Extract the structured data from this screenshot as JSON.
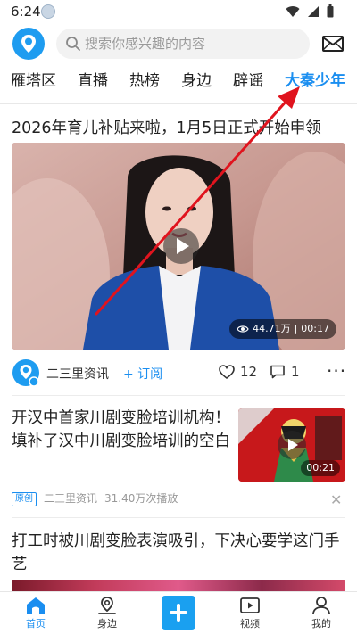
{
  "status_bar": {
    "time": "6:24",
    "icons": [
      "user-status-icon",
      "wifi-icon",
      "signal-icon",
      "battery-icon"
    ]
  },
  "header": {
    "logo_icon": "location-pin-logo-icon",
    "search": {
      "placeholder": "搜索你感兴趣的内容"
    },
    "mail_icon": "mail-icon"
  },
  "tabs": [
    {
      "label": "雁塔区",
      "active": false
    },
    {
      "label": "直播",
      "active": false
    },
    {
      "label": "热榜",
      "active": false
    },
    {
      "label": "身边",
      "active": false
    },
    {
      "label": "辟谣",
      "active": false
    },
    {
      "label": "大秦少年",
      "active": true
    }
  ],
  "featured": {
    "title": "2026年育儿补贴来啦，1月5日正式开始申领",
    "views": "44.71万",
    "duration": "00:17",
    "author": "二三里资讯",
    "subscribe_label": "+ 订阅",
    "likes": "12",
    "comments": "1"
  },
  "article2": {
    "title": "开汉中首家川剧变脸培训机构！填补了汉中川剧变脸培训的空白",
    "badge": "原创",
    "source": "二三里资讯",
    "plays": "31.40万次播放",
    "duration": "00:21"
  },
  "article3": {
    "title": "打工时被川剧变脸表演吸引，下决心要学这门手艺"
  },
  "bottom_nav": [
    {
      "label": "首页",
      "icon": "home-icon",
      "active": true
    },
    {
      "label": "身边",
      "icon": "nearby-pin-icon",
      "active": false
    },
    {
      "label": "",
      "icon": "publish-plus-icon",
      "active": false
    },
    {
      "label": "视频",
      "icon": "video-icon",
      "active": false
    },
    {
      "label": "我的",
      "icon": "profile-icon",
      "active": false
    }
  ],
  "colors": {
    "accent": "#1a8ef0",
    "annotation_arrow": "#e0141e"
  }
}
